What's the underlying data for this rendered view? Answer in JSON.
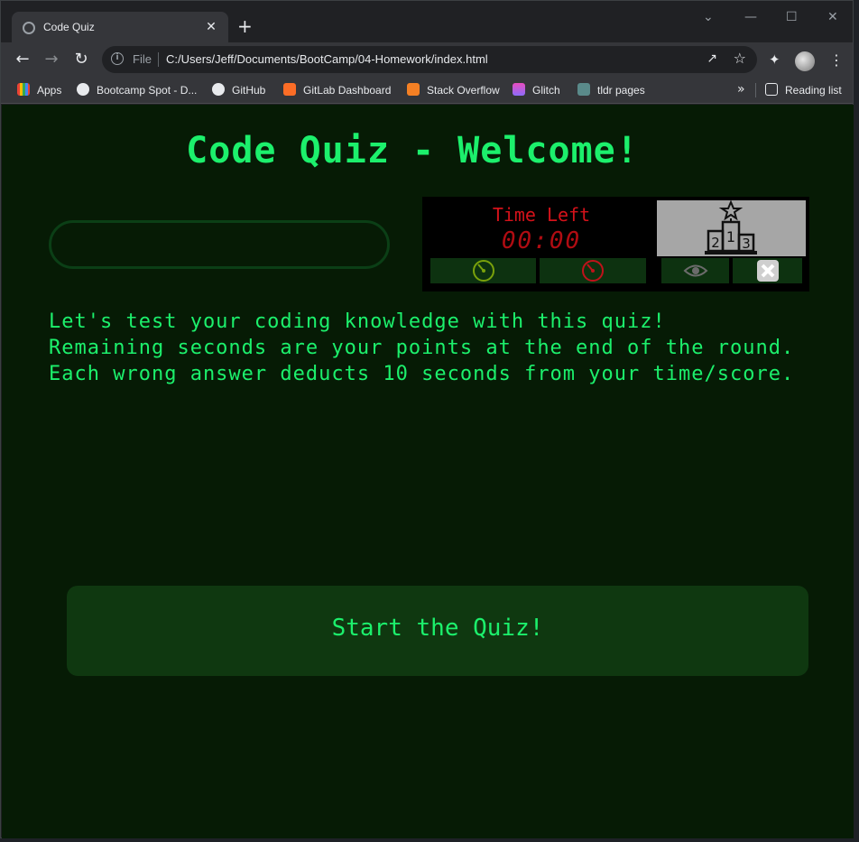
{
  "browser": {
    "tab_title": "Code Quiz",
    "tab_close": "✕",
    "new_tab": "+",
    "address_scheme": "File",
    "url": "C:/Users/Jeff/Documents/BootCamp/04-Homework/index.html",
    "window_controls": [
      "⌄",
      "—",
      "☐",
      "✕"
    ],
    "bookmarks": [
      {
        "label": "Apps",
        "icon": "apps-grid-icon",
        "color": "#ea4335"
      },
      {
        "label": "Bootcamp Spot - D...",
        "icon": "globe-icon",
        "color": "#e8eaed"
      },
      {
        "label": "GitHub",
        "icon": "github-icon",
        "color": "#e8eaed"
      },
      {
        "label": "GitLab Dashboard",
        "icon": "gitlab-icon",
        "color": "#fc6d26"
      },
      {
        "label": "Stack Overflow",
        "icon": "stackoverflow-icon",
        "color": "#f48024"
      },
      {
        "label": "Glitch",
        "icon": "glitch-icon",
        "color": "#8d6cfa"
      },
      {
        "label": "tldr pages",
        "icon": "terminal-icon",
        "color": "#5a8a8a"
      }
    ],
    "more_bookmarks": "»",
    "reading_list": "Reading list"
  },
  "page": {
    "heading": "Code Quiz - Welcome!",
    "timer": {
      "label": "Time Left",
      "value": "00:00"
    },
    "intro_lines": [
      "Let's test your coding knowledge with this quiz!",
      "Remaining seconds are your points at the end of the round.",
      "Each wrong answer deducts 10 seconds from your time/score."
    ],
    "start_button": "Start the Quiz!"
  },
  "colors": {
    "accent_green": "#1cf06c",
    "page_bg": "#061b05",
    "timer_red": "#d4121a",
    "button_bg": "#0f3810"
  }
}
